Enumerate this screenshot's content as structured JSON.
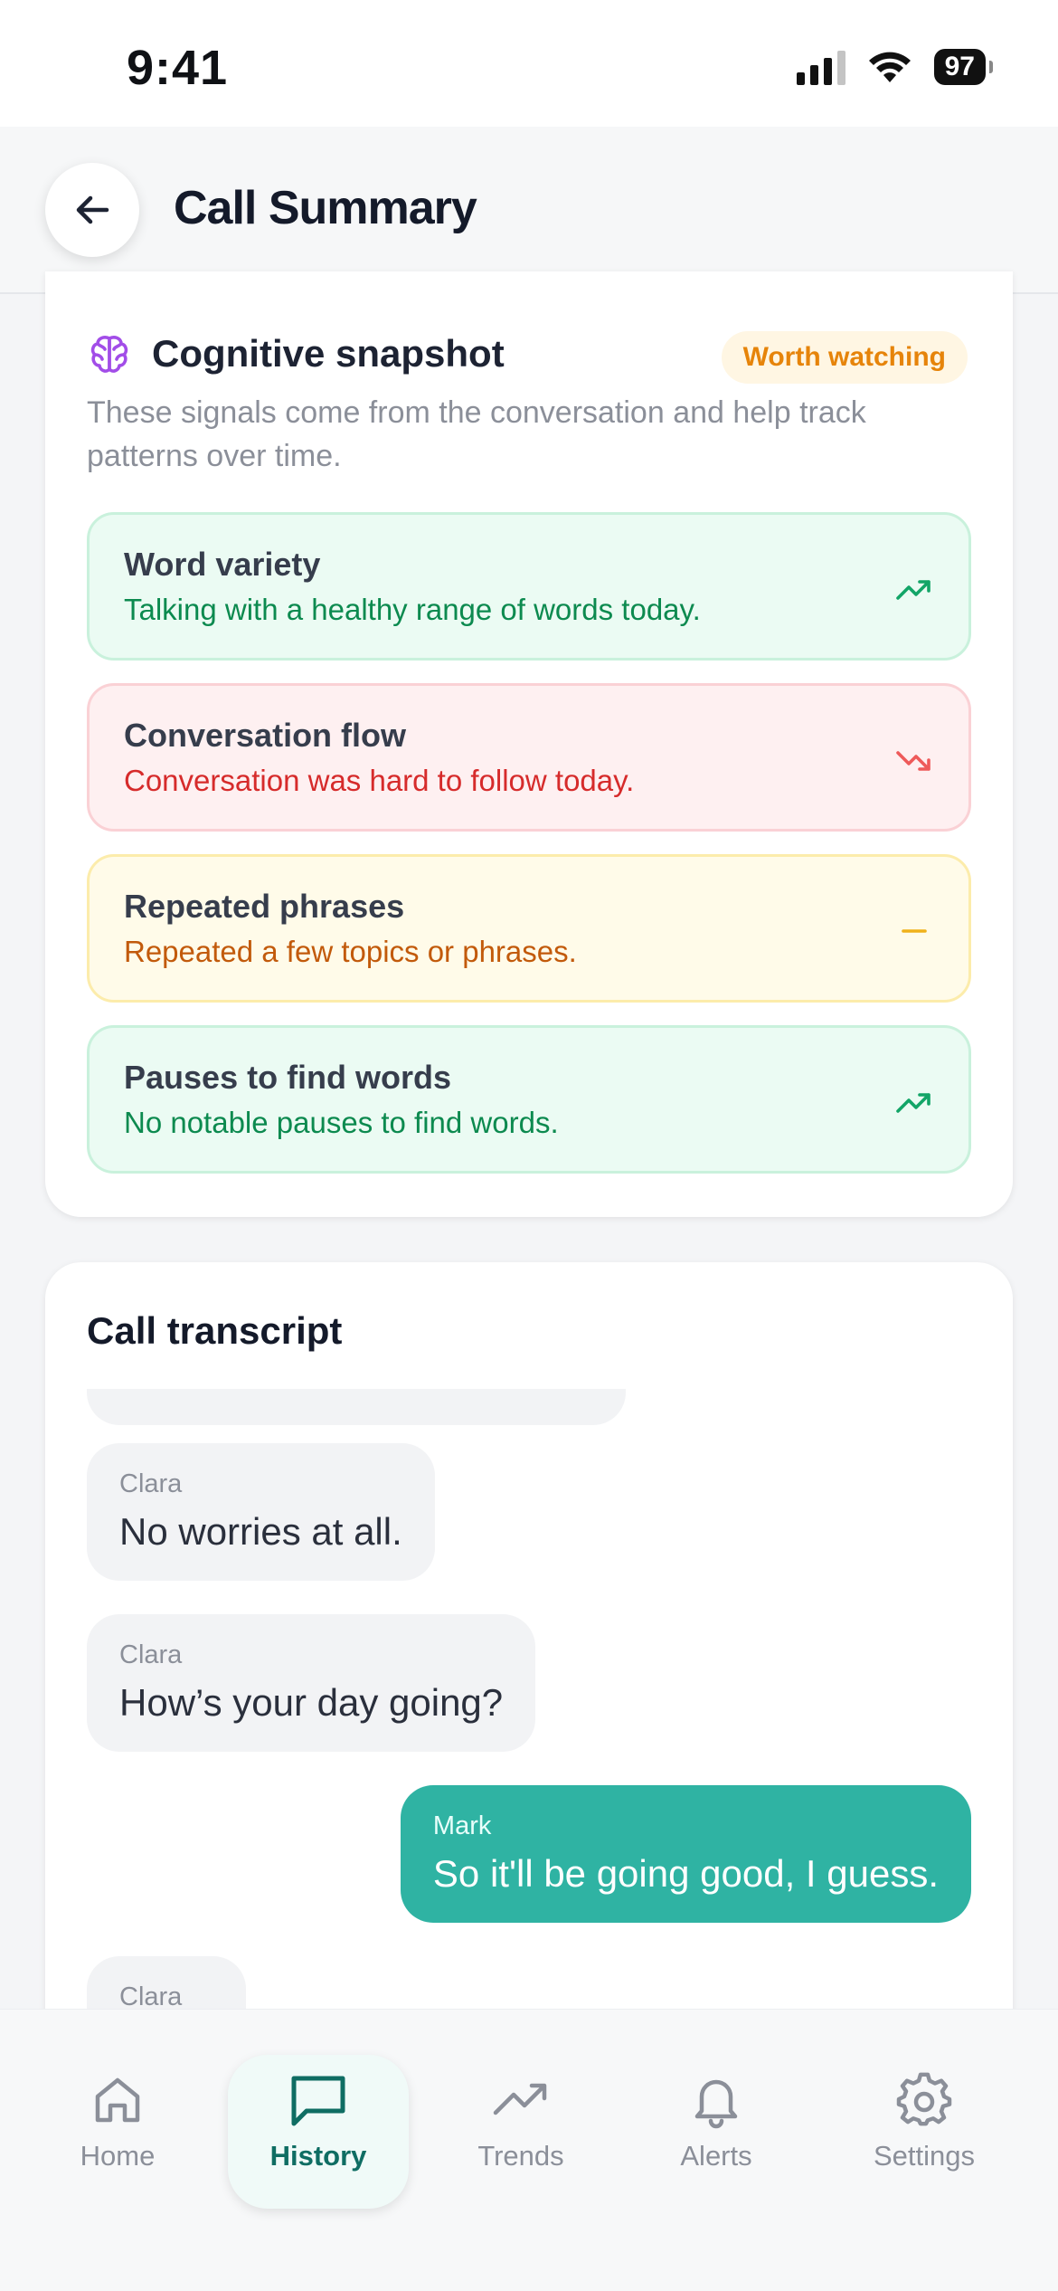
{
  "status_bar": {
    "time": "9:41",
    "battery": "97"
  },
  "header": {
    "title": "Call Summary"
  },
  "snapshot": {
    "title": "Cognitive snapshot",
    "badge": "Worth watching",
    "description": "These signals come from the conversation and help track patterns over time.",
    "signals": [
      {
        "title": "Word variety",
        "detail": "Talking with a healthy range of words today.",
        "trend": "up",
        "tone": "green"
      },
      {
        "title": "Conversation flow",
        "detail": "Conversation was hard to follow today.",
        "trend": "down",
        "tone": "red"
      },
      {
        "title": "Repeated phrases",
        "detail": "Repeated a few topics or phrases.",
        "trend": "flat",
        "tone": "yellow"
      },
      {
        "title": "Pauses to find words",
        "detail": "No notable pauses to find words.",
        "trend": "up",
        "tone": "green"
      }
    ]
  },
  "transcript": {
    "title": "Call transcript",
    "messages": [
      {
        "speaker": "Clara",
        "text": "No worries at all."
      },
      {
        "speaker": "Clara",
        "text": "How’s your day going?"
      },
      {
        "speaker": "Mark",
        "text": "So it'll be going good, I guess."
      },
      {
        "speaker": "Clara",
        "text": ""
      }
    ]
  },
  "tabs": [
    {
      "label": "Home",
      "icon": "home-icon"
    },
    {
      "label": "History",
      "icon": "chat-bubble-icon",
      "active": true
    },
    {
      "label": "Trends",
      "icon": "trending-up-icon"
    },
    {
      "label": "Alerts",
      "icon": "bell-icon"
    },
    {
      "label": "Settings",
      "icon": "gear-icon"
    }
  ],
  "colors": {
    "accent": "#2fb3a3",
    "badge": "#e6840a",
    "positive": "#0c8a4f",
    "negative": "#d62b2b",
    "neutral": "#c25a0b"
  }
}
